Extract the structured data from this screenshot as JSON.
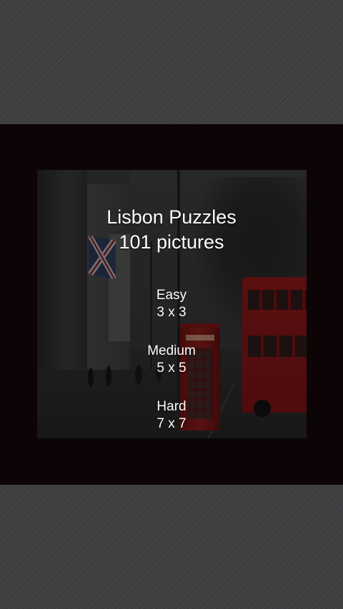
{
  "menu": {
    "title_line1": "Lisbon Puzzles",
    "title_line2": "101 pictures",
    "options": [
      {
        "label": "Easy",
        "size": "3 x 3"
      },
      {
        "label": "Medium",
        "size": "5 x 5"
      },
      {
        "label": "Hard",
        "size": "7 x 7"
      }
    ]
  },
  "colors": {
    "background": "#3c3d3f",
    "dialog": "#0c0405",
    "text": "#ffffff",
    "bus_red": "#8b1719"
  }
}
